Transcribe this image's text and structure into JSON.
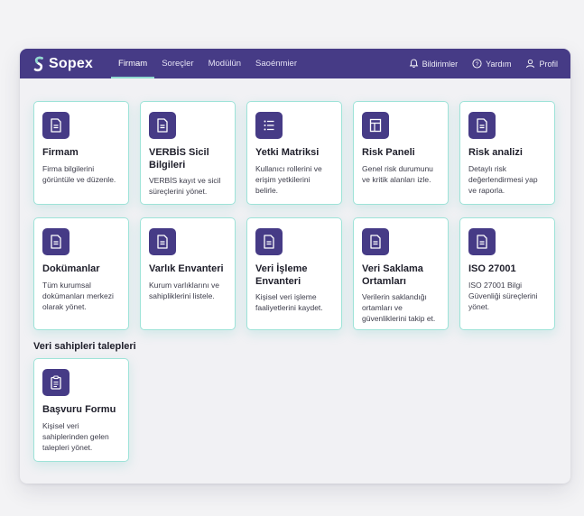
{
  "brand": {
    "name": "Sopex"
  },
  "nav": {
    "links": [
      "Firmam",
      "Soreçler",
      "Modülün",
      "Saoénmier"
    ],
    "active": "Firmam",
    "notifications": "Bildirimler",
    "help": "Yardım",
    "profile": "Profil"
  },
  "cards": [
    {
      "title": "Firmam",
      "desc": "Firma bilgilerini görüntüle ve düzenle.",
      "icon": "document-icon"
    },
    {
      "title": "VERBİS Sicil Bilgileri",
      "desc": "VERBİS kayıt ve sicil süreçlerini yönet.",
      "icon": "document-icon"
    },
    {
      "title": "Yetki Matriksi",
      "desc": "Kullanıcı rollerini ve erişim yetkilerini belirle.",
      "icon": "list-icon"
    },
    {
      "title": "Risk Paneli",
      "desc": "Genel risk durumunu ve kritik alanları izle.",
      "icon": "panel-icon"
    },
    {
      "title": "Risk analizi",
      "desc": "Detaylı risk değerlendirmesi yap ve raporla.",
      "icon": "document-icon"
    },
    {
      "title": "Dokümanlar",
      "desc": "Tüm kurumsal dokümanları merkezi olarak yönet.",
      "icon": "document-icon"
    },
    {
      "title": "Varlık Envanteri",
      "desc": "Kurum varlıklarını ve sahipliklerini listele.",
      "icon": "document-icon"
    },
    {
      "title": "Veri İşleme Envanteri",
      "desc": "Kişisel veri işleme faaliyetlerini kaydet.",
      "icon": "document-icon"
    },
    {
      "title": "Veri Saklama Ortamları",
      "desc": "Verilerin saklandığı ortamları ve güvenliklerini takip et.",
      "icon": "document-icon"
    },
    {
      "title": "ISO 27001",
      "desc": "ISO 27001 Bilgi Güvenliği süreçlerini yönet.",
      "icon": "document-icon"
    }
  ],
  "section": {
    "title": "Veri sahipleri talepleri",
    "cards": [
      {
        "title": "Başvuru Formu",
        "desc": "Kişisel veri sahiplerinden gelen talepleri yönet.",
        "icon": "clipboard-icon"
      }
    ]
  },
  "colors": {
    "nav_bg": "#463b86",
    "accent": "#9ee3d8",
    "icon_bg": "#463b86"
  }
}
